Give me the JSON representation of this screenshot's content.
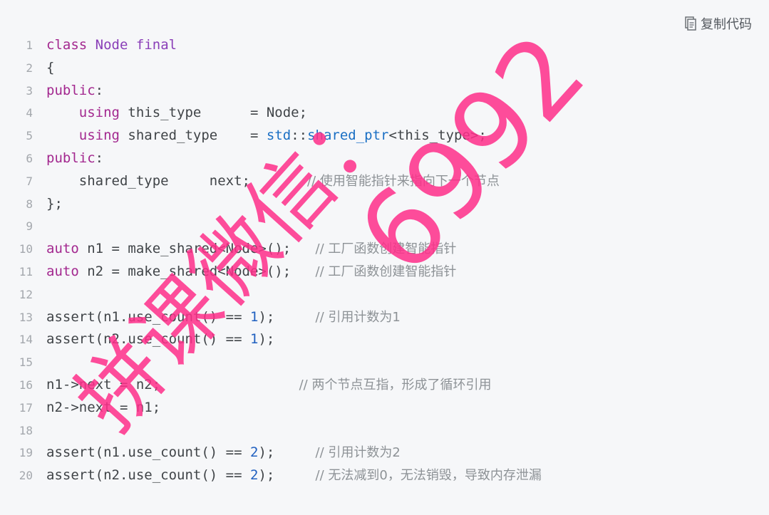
{
  "toolbar": {
    "copy_label": "复制代码",
    "copy_icon": "copy-icon"
  },
  "code_lines": [
    {
      "n": "1",
      "tokens": [
        {
          "t": "class",
          "c": "kw"
        },
        {
          "t": " "
        },
        {
          "t": "Node",
          "c": "type"
        },
        {
          "t": " "
        },
        {
          "t": "final",
          "c": "type"
        }
      ]
    },
    {
      "n": "2",
      "tokens": [
        {
          "t": "{"
        }
      ]
    },
    {
      "n": "3",
      "tokens": [
        {
          "t": "public",
          "c": "kw"
        },
        {
          "t": ":"
        }
      ]
    },
    {
      "n": "4",
      "tokens": [
        {
          "t": "    "
        },
        {
          "t": "using",
          "c": "kw"
        },
        {
          "t": " this_type      = Node;"
        }
      ]
    },
    {
      "n": "5",
      "tokens": [
        {
          "t": "    "
        },
        {
          "t": "using",
          "c": "kw"
        },
        {
          "t": " shared_type    = "
        },
        {
          "t": "std",
          "c": "ns"
        },
        {
          "t": "::"
        },
        {
          "t": "shared_ptr",
          "c": "ns"
        },
        {
          "t": "<this_type>;"
        }
      ]
    },
    {
      "n": "6",
      "tokens": [
        {
          "t": "public",
          "c": "kw"
        },
        {
          "t": ":"
        }
      ]
    },
    {
      "n": "7",
      "tokens": [
        {
          "t": "    shared_type     next;       "
        },
        {
          "t": "// 使用智能指针来指向下一个节点",
          "c": "cmt"
        }
      ]
    },
    {
      "n": "8",
      "tokens": [
        {
          "t": "};"
        }
      ]
    },
    {
      "n": "9",
      "tokens": []
    },
    {
      "n": "10",
      "tokens": [
        {
          "t": "auto",
          "c": "kw"
        },
        {
          "t": " n1 = make_shared<Node>();   "
        },
        {
          "t": "// 工厂函数创建智能指针",
          "c": "cmt"
        }
      ]
    },
    {
      "n": "11",
      "tokens": [
        {
          "t": "auto",
          "c": "kw"
        },
        {
          "t": " n2 = make_shared<Node>();   "
        },
        {
          "t": "// 工厂函数创建智能指针",
          "c": "cmt"
        }
      ]
    },
    {
      "n": "12",
      "tokens": []
    },
    {
      "n": "13",
      "tokens": [
        {
          "t": "assert(n1.use_count() == "
        },
        {
          "t": "1",
          "c": "num"
        },
        {
          "t": ");     "
        },
        {
          "t": "// 引用计数为1",
          "c": "cmt"
        }
      ]
    },
    {
      "n": "14",
      "tokens": [
        {
          "t": "assert(n2.use_count() == "
        },
        {
          "t": "1",
          "c": "num"
        },
        {
          "t": ");"
        }
      ]
    },
    {
      "n": "15",
      "tokens": []
    },
    {
      "n": "16",
      "tokens": [
        {
          "t": "n1->next = n2;                 "
        },
        {
          "t": "// 两个节点互指，形成了循环引用",
          "c": "cmt"
        }
      ]
    },
    {
      "n": "17",
      "tokens": [
        {
          "t": "n2->next = n1;"
        }
      ]
    },
    {
      "n": "18",
      "tokens": []
    },
    {
      "n": "19",
      "tokens": [
        {
          "t": "assert(n1.use_count() == "
        },
        {
          "t": "2",
          "c": "num"
        },
        {
          "t": ");     "
        },
        {
          "t": "// 引用计数为2",
          "c": "cmt"
        }
      ]
    },
    {
      "n": "20",
      "tokens": [
        {
          "t": "assert(n2.use_count() == "
        },
        {
          "t": "2",
          "c": "num"
        },
        {
          "t": ");     "
        },
        {
          "t": "// 无法减到0，无法销毁，导致内存泄漏",
          "c": "cmt"
        }
      ]
    }
  ],
  "watermark": {
    "text1": "拼课微信：",
    "text2": "6992"
  }
}
